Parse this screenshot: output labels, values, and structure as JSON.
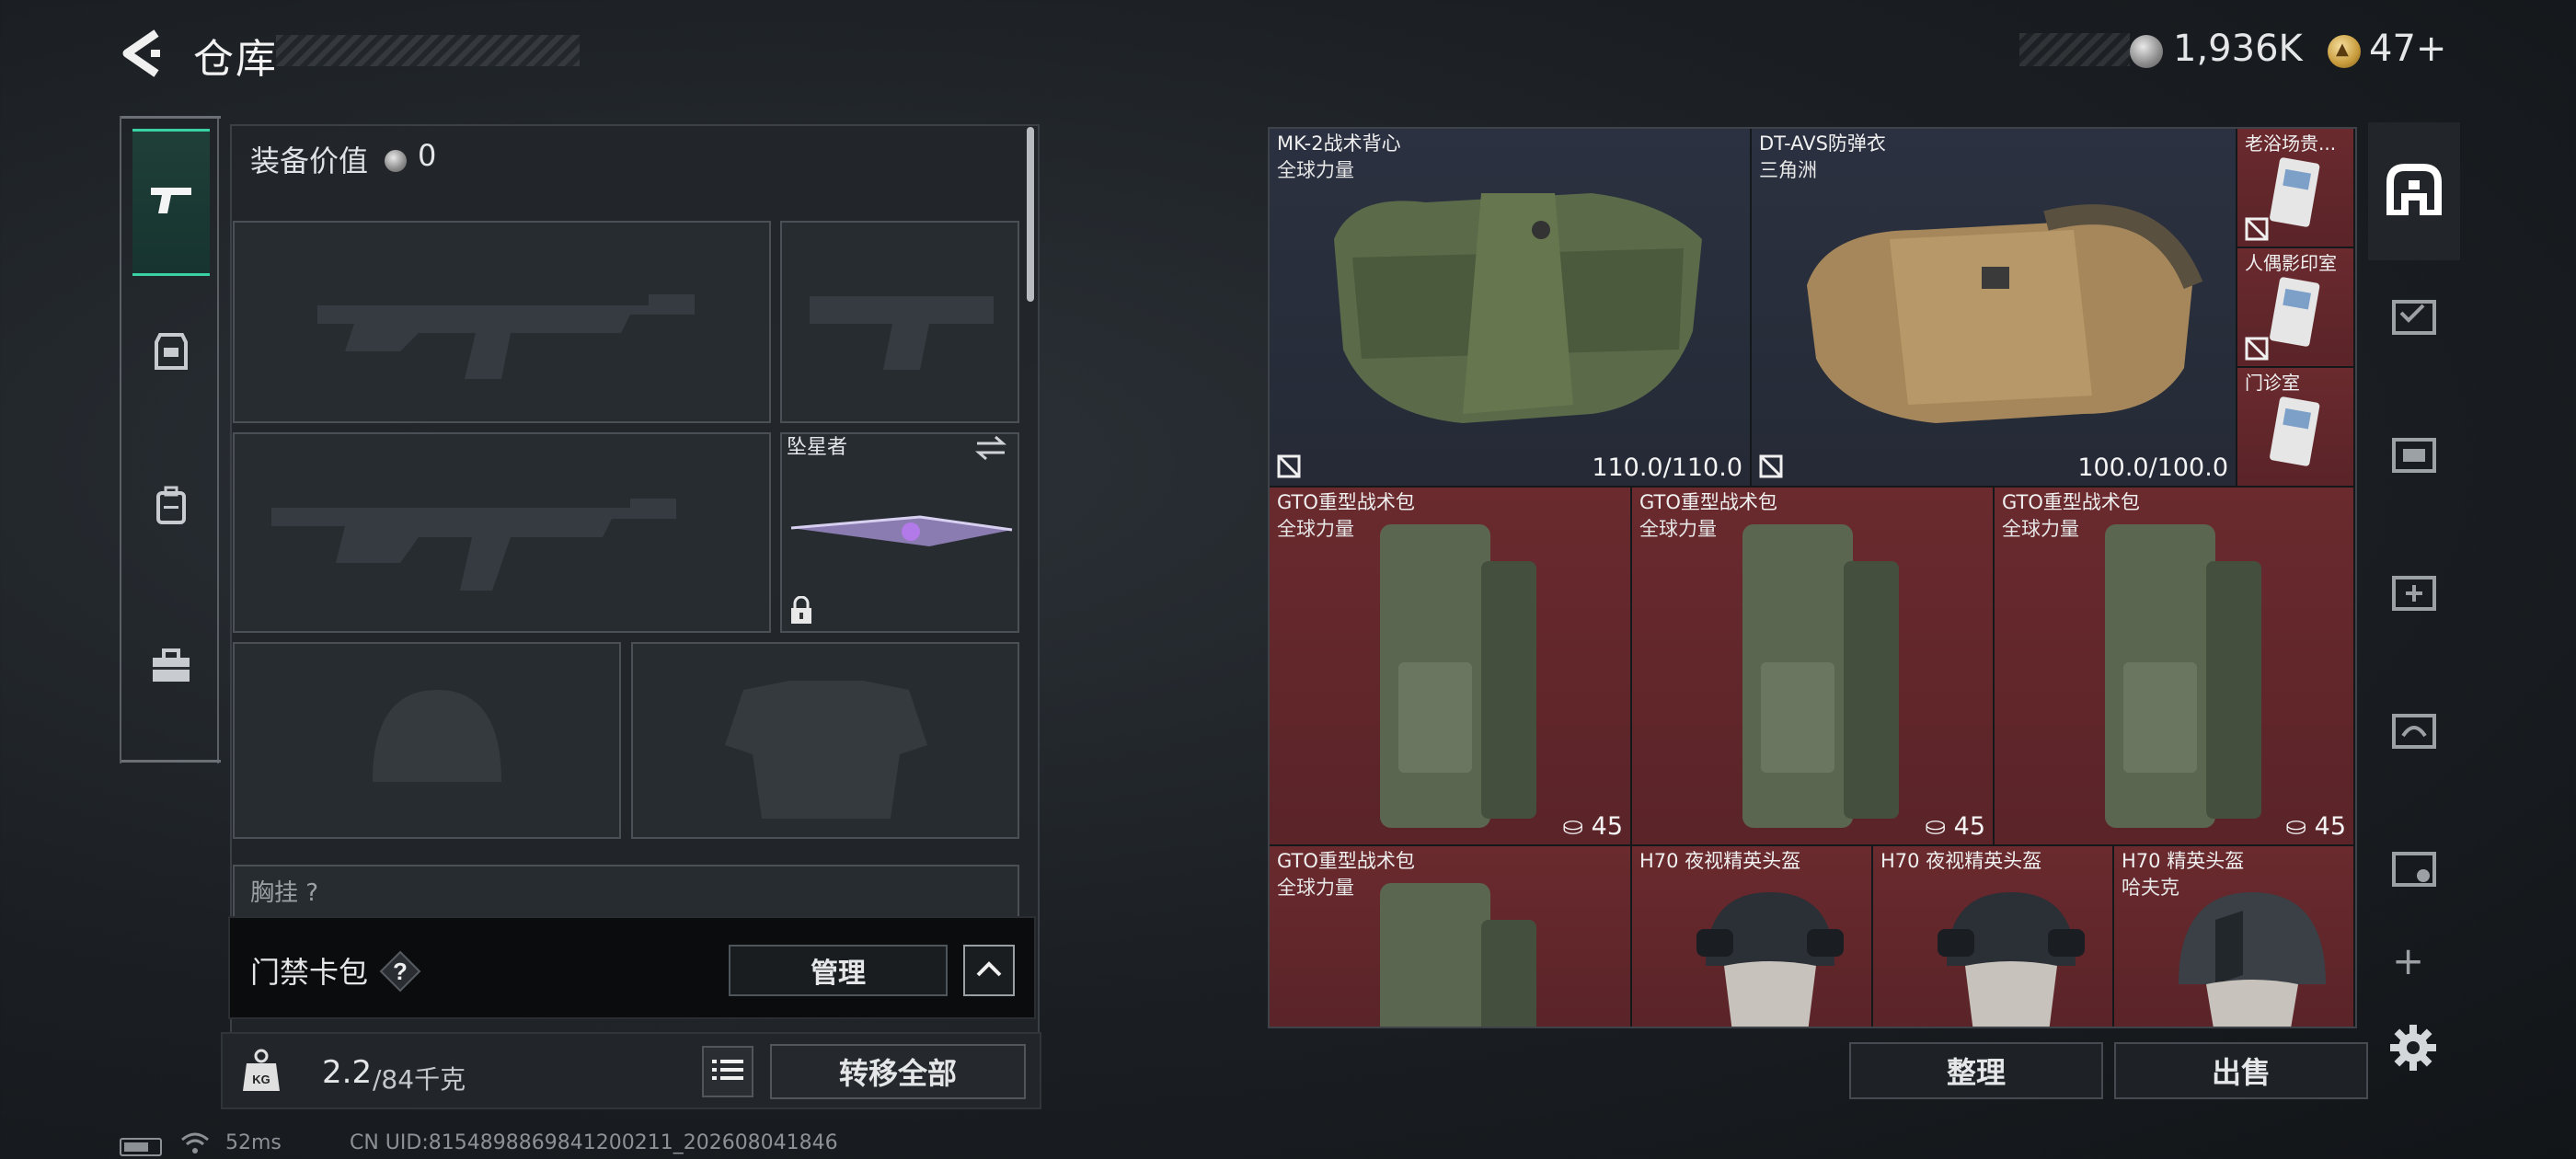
{
  "header": {
    "title": "仓库",
    "currency_silver": "1,936K",
    "currency_gold": "47+"
  },
  "left_nav": {
    "items": [
      {
        "icon": "pistol-icon",
        "active": true
      },
      {
        "icon": "armor-icon",
        "active": false
      },
      {
        "icon": "backpack-icon",
        "active": false
      },
      {
        "icon": "briefcase-icon",
        "active": false
      }
    ]
  },
  "loadout": {
    "equip_value_label": "装备价值",
    "equip_value": "0",
    "melee_label": "坠星者",
    "chest_rig_label": "胸挂 ?"
  },
  "keycard": {
    "label": "门禁卡包",
    "help": "?",
    "manage_label": "管理"
  },
  "weight": {
    "current": "2.2",
    "max": "/84千克",
    "transfer_label": "转移全部"
  },
  "status": {
    "ping": "52ms",
    "uid": "CN UID:8154898869841200211_202608041846"
  },
  "stash": {
    "vests": [
      {
        "name": "MK-2战术背心",
        "sub": "全球力量",
        "durability": "110.0/110.0"
      },
      {
        "name": "DT-AVS防弹衣",
        "sub": "三角洲",
        "durability": "100.0/100.0"
      }
    ],
    "cards": [
      {
        "name": "老浴场贵..."
      },
      {
        "name": "人偶影印室"
      },
      {
        "name": "门诊室"
      }
    ],
    "bags": [
      {
        "name": "GTO重型战术包",
        "sub": "全球力量",
        "capacity": "45"
      },
      {
        "name": "GTO重型战术包",
        "sub": "全球力量",
        "capacity": "45"
      },
      {
        "name": "GTO重型战术包",
        "sub": "全球力量",
        "capacity": "45"
      },
      {
        "name": "GTO重型战术包",
        "sub": "全球力量"
      }
    ],
    "helmets": [
      {
        "name": "H70 夜视精英头盔"
      },
      {
        "name": "H70 夜视精英头盔"
      },
      {
        "name": "H70 精英头盔",
        "sub": "哈夫克"
      }
    ]
  },
  "actions": {
    "sort_label": "整理",
    "sell_label": "出售"
  },
  "colors": {
    "accent": "#39d2a6",
    "red_cell": "#6a2a2e",
    "blue_cell": "#2b3140"
  }
}
